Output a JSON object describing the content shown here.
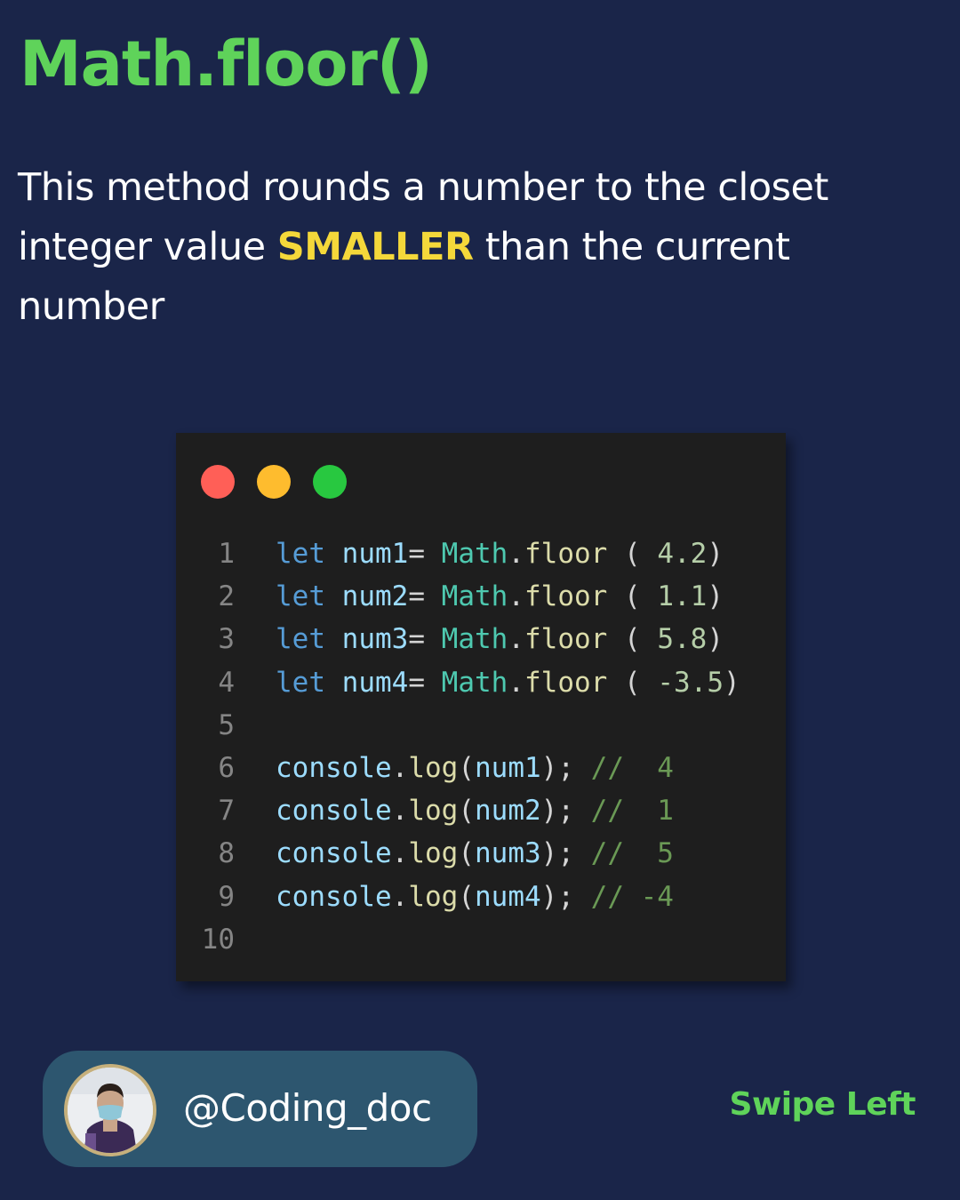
{
  "title": "Math.floor()",
  "description": {
    "before": "This method rounds a number to the closet integer value ",
    "highlight": "SMALLER",
    "after": " than the current number"
  },
  "colors": {
    "background": "#1a2549",
    "title": "#5fd35a",
    "highlight": "#f4d83a",
    "editor_bg": "#1e1e1e",
    "handle_bg": "#2d566f"
  },
  "code_editor": {
    "window_buttons": [
      "close-dot",
      "minimize-dot",
      "maximize-dot"
    ],
    "lines": [
      {
        "n": "1",
        "keyword": "let",
        "var": "num1",
        "op": "=",
        "obj": "Math",
        "dot": ".",
        "fn": "floor",
        "open": " ( ",
        "arg": "4.2",
        "close": ")"
      },
      {
        "n": "2",
        "keyword": "let",
        "var": "num2",
        "op": "=",
        "obj": "Math",
        "dot": ".",
        "fn": "floor",
        "open": " ( ",
        "arg": "1.1",
        "close": ")"
      },
      {
        "n": "3",
        "keyword": "let",
        "var": "num3",
        "op": "=",
        "obj": "Math",
        "dot": ".",
        "fn": "floor",
        "open": " ( ",
        "arg": "5.8",
        "close": ")"
      },
      {
        "n": "4",
        "keyword": "let",
        "var": "num4",
        "op": "=",
        "obj": "Math",
        "dot": ".",
        "fn": "floor",
        "open": " ( ",
        "arg": "-3.5",
        "close": ")"
      },
      {
        "n": "5"
      },
      {
        "n": "6",
        "obj": "console",
        "dot": ".",
        "fn": "log",
        "open": "(",
        "arg": "num1",
        "close": ");",
        "comment": "//  4"
      },
      {
        "n": "7",
        "obj": "console",
        "dot": ".",
        "fn": "log",
        "open": "(",
        "arg": "num2",
        "close": ");",
        "comment": "//  1"
      },
      {
        "n": "8",
        "obj": "console",
        "dot": ".",
        "fn": "log",
        "open": "(",
        "arg": "num3",
        "close": ");",
        "comment": "//  5"
      },
      {
        "n": "9",
        "obj": "console",
        "dot": ".",
        "fn": "log",
        "open": "(",
        "arg": "num4",
        "close": ");",
        "comment": "// -4"
      },
      {
        "n": "10"
      }
    ]
  },
  "footer": {
    "handle": "@Coding_doc",
    "swipe": "Swipe Left"
  }
}
